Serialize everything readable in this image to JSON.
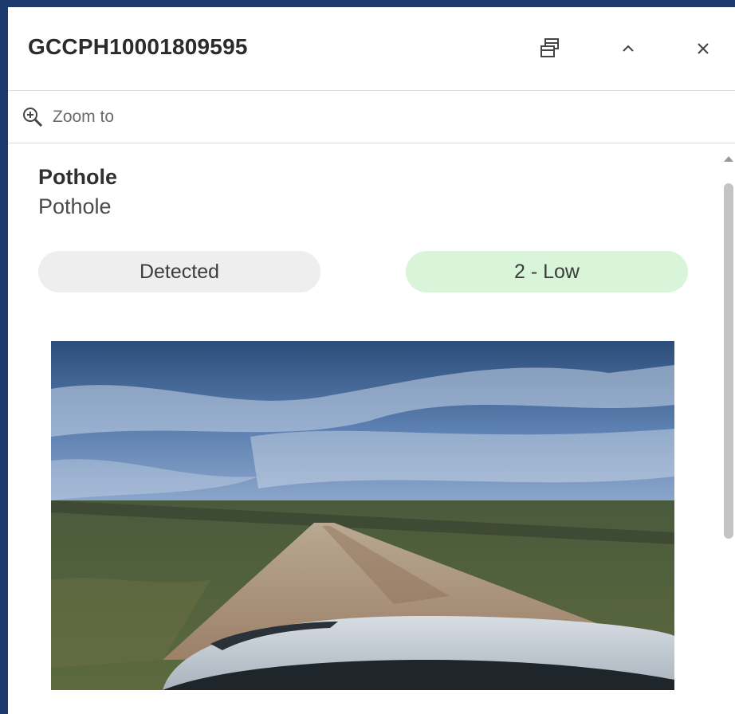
{
  "header": {
    "title": "GCCPH10001809595",
    "dock_icon": "dock-icon",
    "collapse_icon": "chevron-up-icon",
    "close_icon": "close-icon"
  },
  "toolbar": {
    "zoom_label": "Zoom to",
    "zoom_icon": "zoom-in-icon"
  },
  "feature": {
    "title": "Pothole",
    "subtitle": "Pothole",
    "status": "Detected",
    "priority": "2 - Low"
  },
  "colors": {
    "frame_background": "#1b3a6b",
    "status_pill": "#eeeeee",
    "priority_pill": "#d9f5d9"
  }
}
